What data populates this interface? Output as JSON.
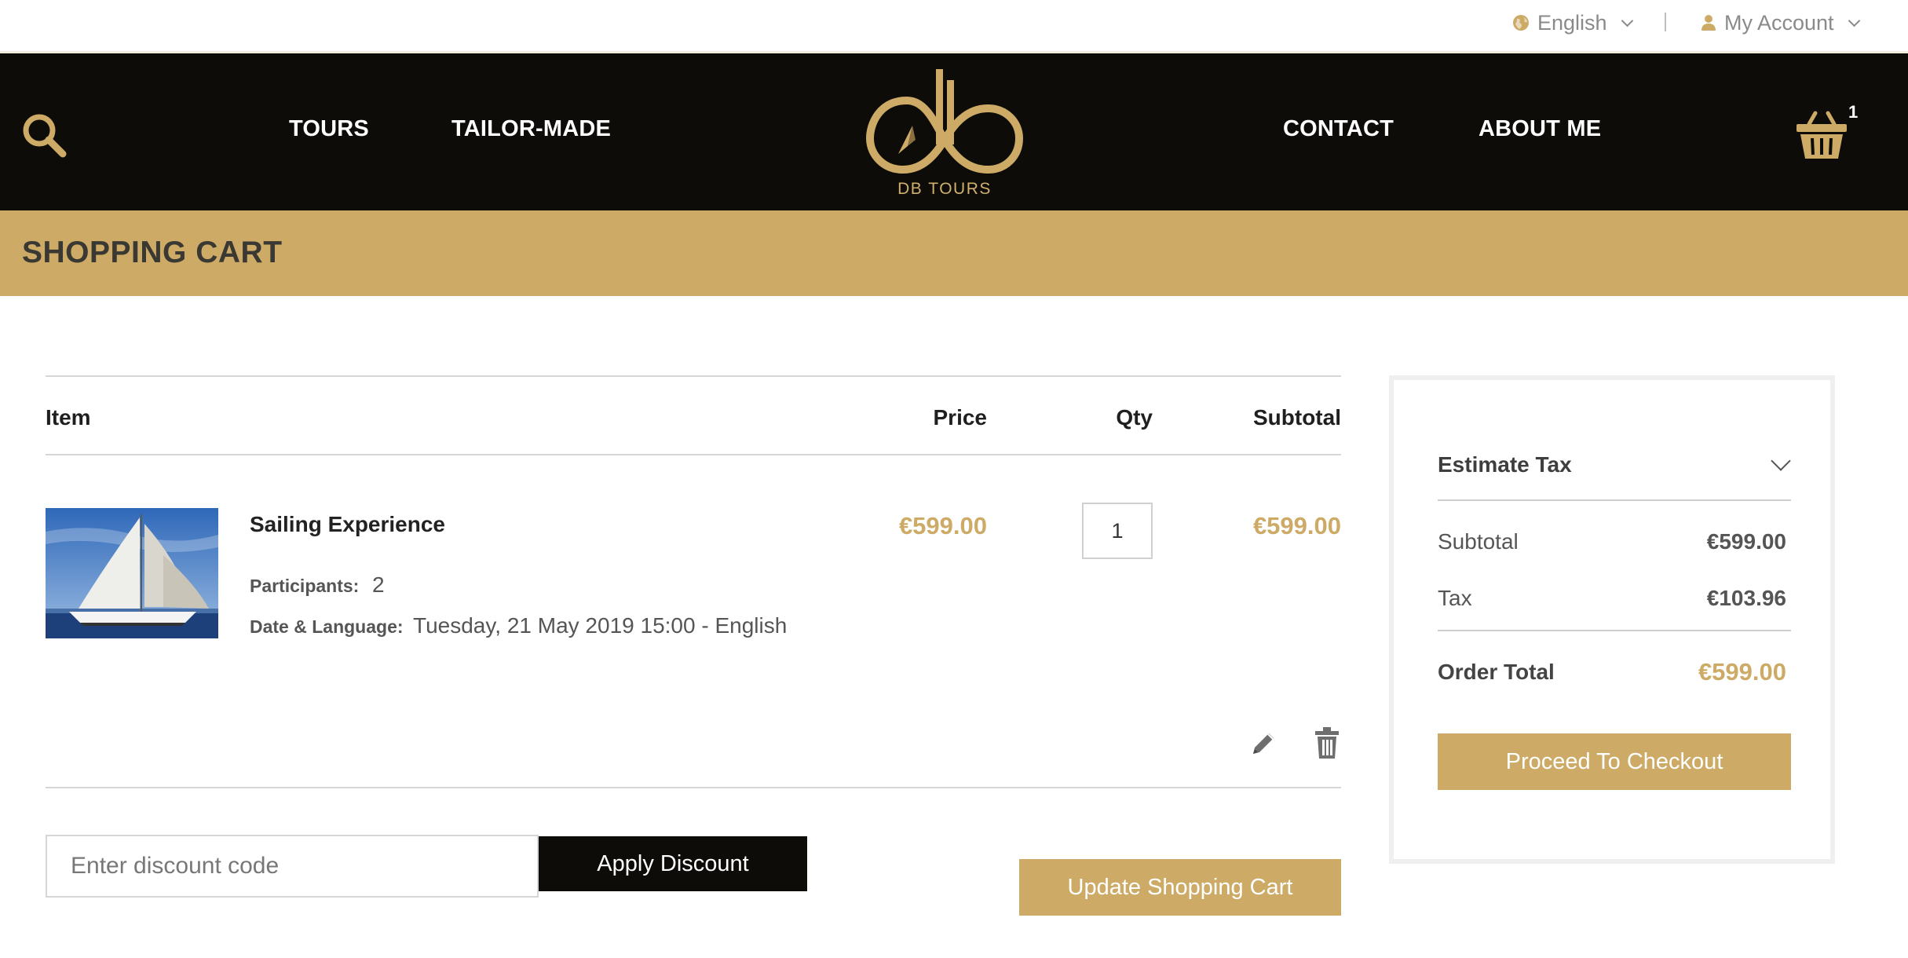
{
  "topbar": {
    "language_label": "English",
    "account_label": "My Account"
  },
  "nav": {
    "tours": "TOURS",
    "tailor_made": "TAILOR-MADE",
    "contact": "CONTACT",
    "about": "ABOUT ME",
    "logo_text": "DB TOURS",
    "cart_count": "1"
  },
  "page": {
    "title": "SHOPPING CART"
  },
  "table": {
    "headers": {
      "item": "Item",
      "price": "Price",
      "qty": "Qty",
      "subtotal": "Subtotal"
    },
    "rows": [
      {
        "name": "Sailing Experience",
        "options": [
          {
            "label": "Participants:",
            "value": "2"
          },
          {
            "label": "Date & Language:",
            "value": "Tuesday, 21 May 2019 15:00 - English"
          }
        ],
        "price": "€599.00",
        "qty": "1",
        "subtotal": "€599.00"
      }
    ]
  },
  "discount": {
    "placeholder": "Enter discount code",
    "apply_label": "Apply Discount"
  },
  "actions": {
    "update_label": "Update Shopping Cart"
  },
  "summary": {
    "estimate_tax_label": "Estimate Tax",
    "subtotal_label": "Subtotal",
    "subtotal_value": "€599.00",
    "tax_label": "Tax",
    "tax_value": "€103.96",
    "order_total_label": "Order Total",
    "order_total_value": "€599.00",
    "checkout_label": "Proceed To Checkout"
  },
  "colors": {
    "accent_gold": "#cdab66",
    "nav_black": "#0d0c09",
    "muted_text": "#8a8a8a"
  },
  "icons": {
    "language": "globe-icon",
    "account": "user-icon",
    "search": "search-icon",
    "cart": "basket-icon",
    "edit": "pencil-icon",
    "remove": "trash-icon",
    "expand": "chevron-down-icon"
  }
}
